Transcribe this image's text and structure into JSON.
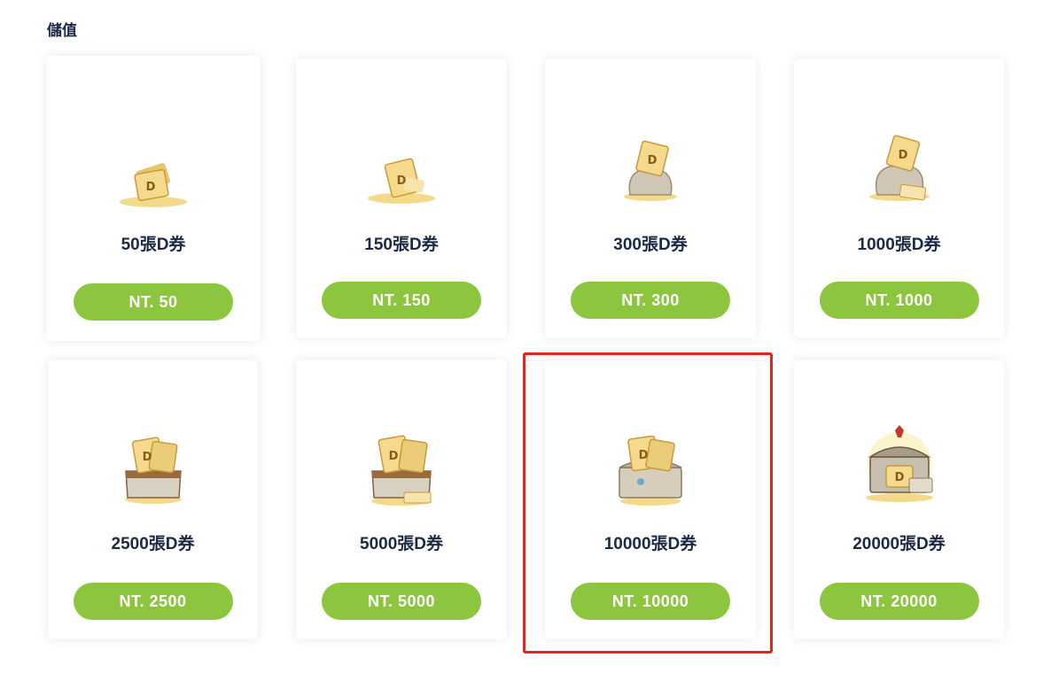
{
  "section": {
    "title": "儲值"
  },
  "items": [
    {
      "name": "50張D券",
      "price": "NT. 50",
      "icon": "d-ticket-small-pile-icon"
    },
    {
      "name": "150張D券",
      "price": "NT. 150",
      "icon": "d-ticket-pile-icon"
    },
    {
      "name": "300張D券",
      "price": "NT. 300",
      "icon": "d-ticket-bag-icon"
    },
    {
      "name": "1000張D券",
      "price": "NT. 1000",
      "icon": "d-ticket-bag-large-icon"
    },
    {
      "name": "2500張D券",
      "price": "NT. 2500",
      "icon": "d-ticket-satchel-icon"
    },
    {
      "name": "5000張D券",
      "price": "NT. 5000",
      "icon": "d-ticket-satchel-large-icon"
    },
    {
      "name": "10000張D券",
      "price": "NT. 10000",
      "icon": "d-ticket-chest-icon"
    },
    {
      "name": "20000張D券",
      "price": "NT. 20000",
      "icon": "d-ticket-treasure-chest-icon"
    }
  ],
  "colors": {
    "button": "#8cc63f",
    "title_text": "#1b2a44",
    "highlight_border": "#e8231c",
    "gold": "#e8c068"
  }
}
